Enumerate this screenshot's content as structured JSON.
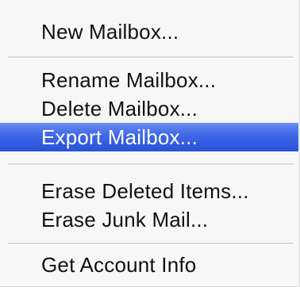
{
  "menu": {
    "items": [
      {
        "label": "New Mailbox..."
      },
      {
        "label": "Rename Mailbox..."
      },
      {
        "label": "Delete Mailbox..."
      },
      {
        "label": "Export Mailbox...",
        "selected": true
      },
      {
        "label": "Erase Deleted Items..."
      },
      {
        "label": "Erase Junk Mail..."
      },
      {
        "label": "Get Account Info"
      }
    ],
    "highlight_color": "#3e66e6"
  }
}
